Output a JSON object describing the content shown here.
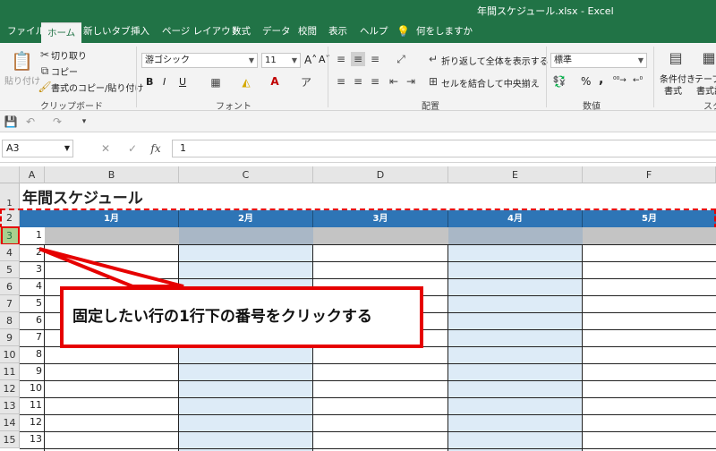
{
  "window": {
    "title": "年間スケジュール.xlsx  -  Excel"
  },
  "ribbon_tabs": [
    "ファイル",
    "ホーム",
    "新しいタブ",
    "挿入",
    "ページ レイアウト",
    "数式",
    "データ",
    "校閲",
    "表示",
    "ヘルプ",
    "何をしますか"
  ],
  "clipboard": {
    "paste": "貼り付け",
    "cut": "切り取り",
    "copy": "コピー",
    "format_painter": "書式のコピー/貼り付け",
    "label": "クリップボード"
  },
  "font": {
    "name": "游ゴシック",
    "size": "11",
    "bold": "B",
    "italic": "I",
    "underline": "U",
    "label": "フォント"
  },
  "alignment": {
    "wrap": "折り返して全体を表示する",
    "merge": "セルを結合して中央揃え",
    "label": "配置"
  },
  "number": {
    "format": "標準",
    "percent": "%",
    "comma": ",",
    "label": "数値"
  },
  "styles": {
    "conditional_line1": "条件付き",
    "conditional_line2": "書式",
    "table_line1": "テーブル",
    "table_line2": "書式設",
    "label": "スタ"
  },
  "formula_bar": {
    "name_box": "A3",
    "fx": "fx",
    "value": "1"
  },
  "columns": [
    "A",
    "B",
    "C",
    "D",
    "E",
    "F"
  ],
  "rows": [
    "1",
    "2",
    "3",
    "4",
    "5",
    "6",
    "7",
    "8",
    "9",
    "10",
    "11",
    "12",
    "13",
    "14",
    "15"
  ],
  "sheet": {
    "title": "年間スケジュール",
    "months": [
      "1月",
      "2月",
      "3月",
      "4月",
      "5月"
    ],
    "day_numbers": [
      "1",
      "2",
      "3",
      "4",
      "5",
      "6",
      "7",
      "8",
      "9",
      "10",
      "11",
      "12",
      "13"
    ]
  },
  "annotation": {
    "text": "固定したい行の1行下の番号をクリックする"
  },
  "colors": {
    "accent": "#217346",
    "header_fill": "#2e75b6",
    "shade": "#ddebf7",
    "highlight": "#e60000"
  }
}
